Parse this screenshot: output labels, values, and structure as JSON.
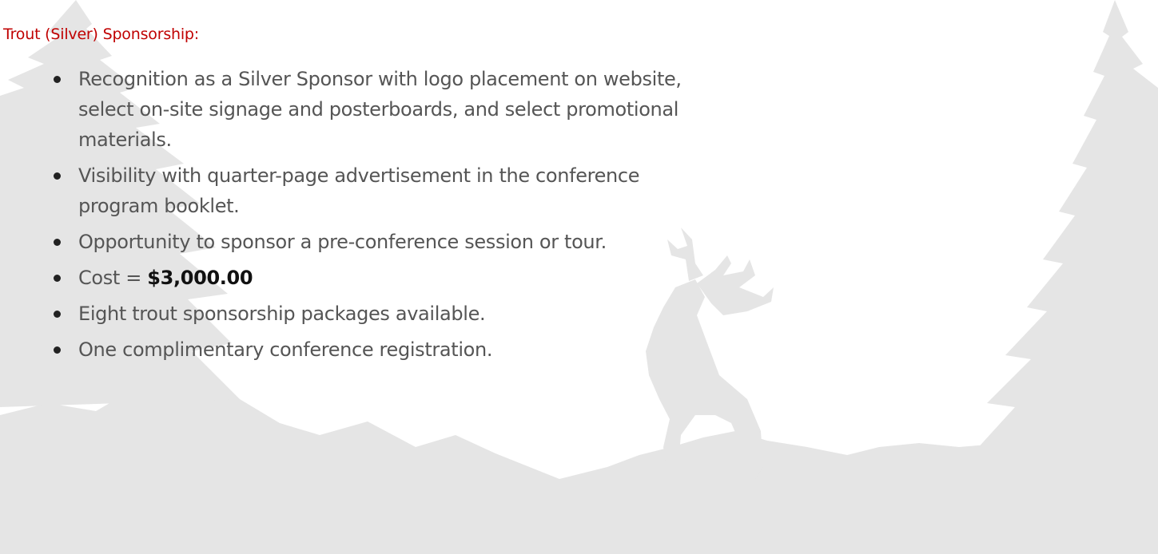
{
  "heading": "Trout (Silver) Sponsorship:",
  "bullets": [
    "Recognition as a Silver Sponsor with logo placement on website, select on-site signage and posterboards, and select promotional materials.",
    "Visibility with quarter-page advertisement in the conference program booklet.",
    "Opportunity to sponsor a pre-conference session or tour.",
    "Eight trout sponsorship packages available.",
    "One complimentary conference registration."
  ],
  "cost": {
    "label": "Cost = ",
    "value": "$3,000.00"
  },
  "colors": {
    "heading": "#c00000",
    "body_text": "#555555",
    "bullet": "#222222",
    "background_art": "#e4e4e4"
  }
}
